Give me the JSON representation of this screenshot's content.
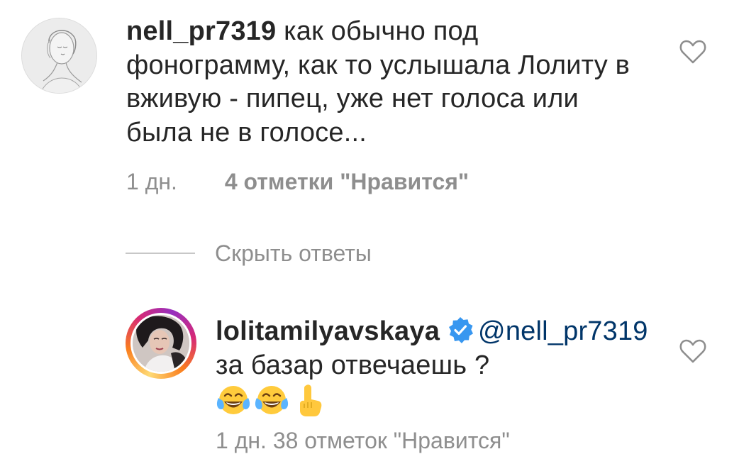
{
  "comment1": {
    "username": "nell_pr7319",
    "text": " как обычно под фонограмму, как то услышала Лолиту в вживую - пипец, уже нет голоса или была не в голосе...",
    "time": "1 дн.",
    "likes": "4 отметки \"Нравится\"",
    "avatar_icon": "sketch-portrait-avatar"
  },
  "hide_replies": "Скрыть ответы",
  "reply1": {
    "username": "lolitamilyavskaya",
    "mention": "@nell_pr7319",
    "text": " за базар отвечаешь ?",
    "emojis": [
      "face-with-tears-of-joy",
      "face-with-tears-of-joy",
      "pointing-up"
    ],
    "meta_partial": "1 дн.    38 отметок \"Нравится\"",
    "avatar_icon": "story-ring-avatar"
  },
  "colors": {
    "text": "#262626",
    "secondary": "#8e8e8e",
    "mention": "#003569",
    "verified": "#3897f0"
  }
}
